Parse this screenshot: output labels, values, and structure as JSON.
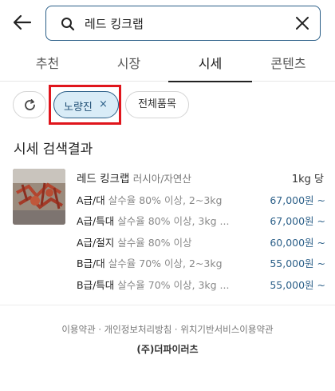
{
  "search": {
    "value": "레드 킹크랩"
  },
  "icons": {
    "back": "arrow-left-icon",
    "search": "search-icon",
    "clear": "close-icon",
    "refresh": "refresh-icon",
    "chip_remove": "close-icon"
  },
  "tabs": [
    {
      "label": "추천",
      "active": false
    },
    {
      "label": "시장",
      "active": false
    },
    {
      "label": "시세",
      "active": true
    },
    {
      "label": "콘텐츠",
      "active": false
    }
  ],
  "filters": {
    "region_chip": {
      "label": "노량진",
      "remove": "×"
    },
    "all_items": "전체품목"
  },
  "section_title": "시세 검색결과",
  "result": {
    "name": "레드 킹크랩",
    "origin": "러시아/자연산",
    "unit": "1kg 당",
    "rows": [
      {
        "grade": "A급/대",
        "desc": "살수율 80% 이상, 2~3kg",
        "price": "67,000원 ~"
      },
      {
        "grade": "A급/특대",
        "desc": "살수율 80% 이상, 3kg ...",
        "price": "67,000원 ~"
      },
      {
        "grade": "A급/절지",
        "desc": "살수율 80% 이상",
        "price": "60,000원 ~"
      },
      {
        "grade": "B급/대",
        "desc": "살수율 70% 이상, 2~3kg",
        "price": "55,000원 ~"
      },
      {
        "grade": "B급/특대",
        "desc": "살수율 70% 이상, 3kg ...",
        "price": "55,000원 ~"
      }
    ]
  },
  "footer": {
    "links": [
      "이용약관",
      "개인정보처리방침",
      "위치기반서비스이용약관"
    ],
    "separator": " · ",
    "company": "(주)더파이러츠"
  },
  "colors": {
    "accent": "#2b5f88",
    "chip_bg": "#d9ecf7",
    "highlight_box": "#e0151c"
  }
}
